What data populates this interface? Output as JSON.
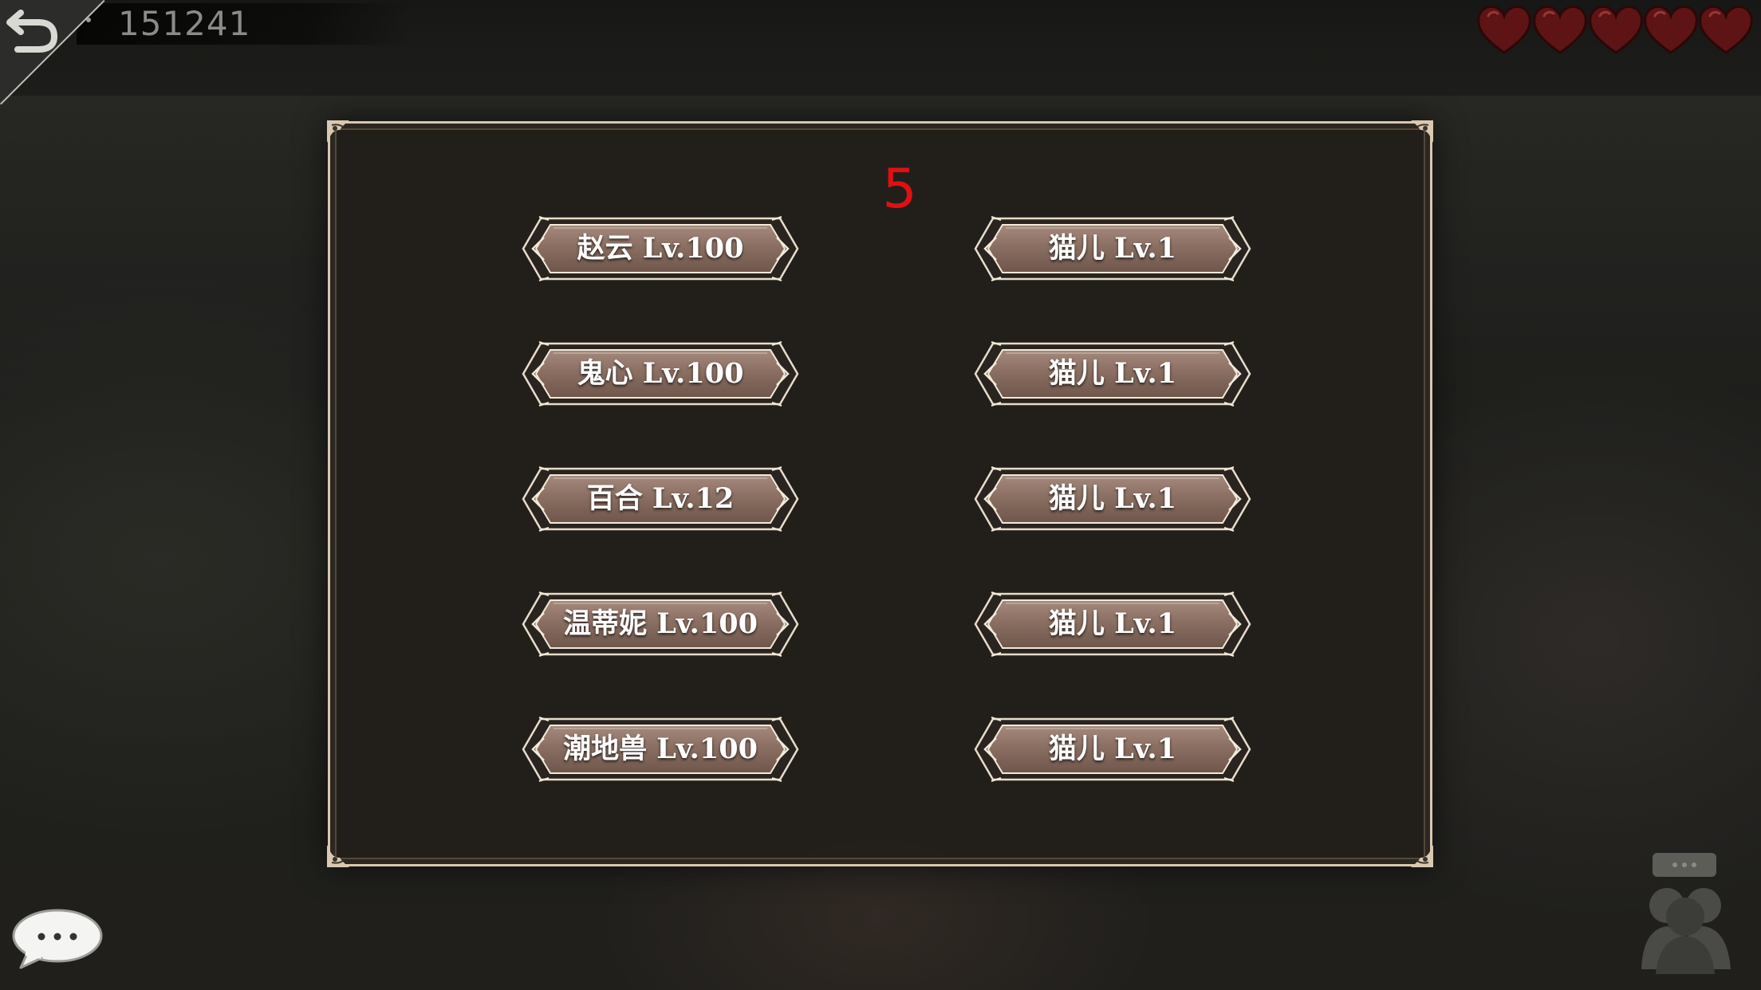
{
  "topbar": {
    "player_id": "151241",
    "lives": 5
  },
  "dialog": {
    "counter": "5",
    "left_column": [
      {
        "label": "赵云 Lv.100"
      },
      {
        "label": "鬼心 Lv.100"
      },
      {
        "label": "百合 Lv.12"
      },
      {
        "label": "温蒂妮 Lv.100"
      },
      {
        "label": "潮地兽 Lv.100"
      }
    ],
    "right_column": [
      {
        "label": "猫儿 Lv.1"
      },
      {
        "label": "猫儿 Lv.1"
      },
      {
        "label": "猫儿 Lv.1"
      },
      {
        "label": "猫儿 Lv.1"
      },
      {
        "label": "猫儿 Lv.1"
      }
    ]
  },
  "icons": {
    "back": "back-arrow-icon",
    "heart": "heart-icon",
    "chat": "chat-bubble-icon",
    "social": "friends-icon"
  },
  "colors": {
    "counter": "#e11010",
    "button_fill": "#8a6f62",
    "heart": "#5e1414",
    "dialog_border": "#d8c9b0"
  }
}
